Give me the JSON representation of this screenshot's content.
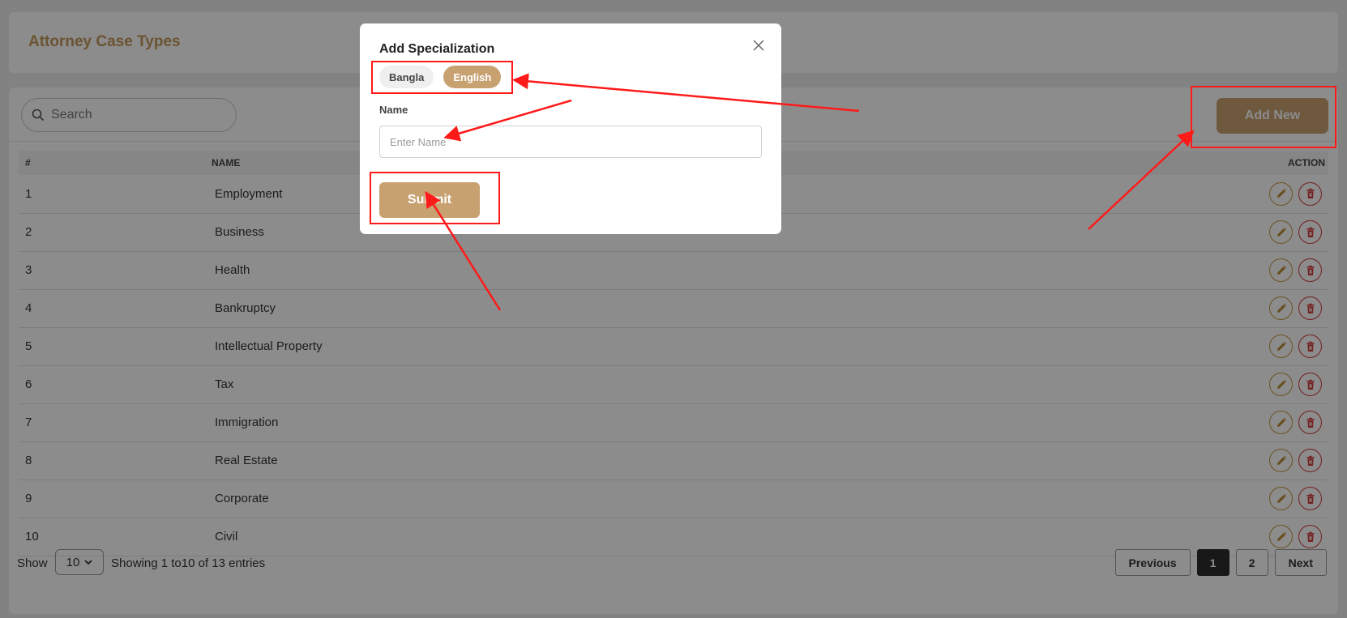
{
  "page": {
    "title": "Attorney Case Types"
  },
  "search": {
    "placeholder": "Search",
    "icon": "search-icon"
  },
  "toolbar": {
    "add_new_label": "Add New"
  },
  "table": {
    "headers": {
      "num": "#",
      "name": "NAME",
      "action": "ACTION"
    },
    "rows": [
      {
        "num": "1",
        "name": "Employment"
      },
      {
        "num": "2",
        "name": "Business"
      },
      {
        "num": "3",
        "name": "Health"
      },
      {
        "num": "4",
        "name": "Bankruptcy"
      },
      {
        "num": "5",
        "name": "Intellectual Property"
      },
      {
        "num": "6",
        "name": "Tax"
      },
      {
        "num": "7",
        "name": "Immigration"
      },
      {
        "num": "8",
        "name": "Real Estate"
      },
      {
        "num": "9",
        "name": "Corporate"
      },
      {
        "num": "10",
        "name": "Civil"
      }
    ]
  },
  "footer": {
    "show_label": "Show",
    "page_size": "10",
    "showing_text": "Showing 1  to10   of 13 entries"
  },
  "pagination": {
    "previous": "Previous",
    "pages": [
      "1",
      "2"
    ],
    "active_page": "1",
    "next": "Next"
  },
  "modal": {
    "title": "Add Specialization",
    "tabs": [
      {
        "label": "Bangla",
        "active": false
      },
      {
        "label": "English",
        "active": true
      }
    ],
    "name_label": "Name",
    "name_placeholder": "Enter Name",
    "name_value": "",
    "submit_label": "Submit"
  },
  "colors": {
    "accent": "#c8a171",
    "title": "#c49a5c",
    "edit": "#c49a3c",
    "delete": "#d23b3b",
    "annotation": "#ff1a1a"
  }
}
